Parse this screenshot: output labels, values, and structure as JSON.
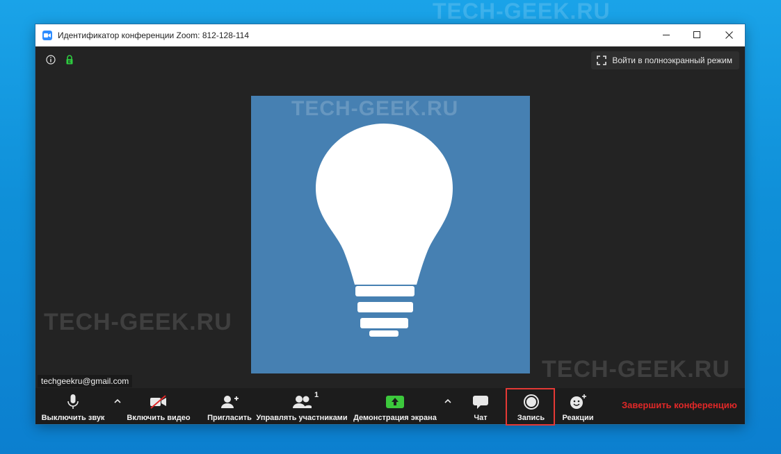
{
  "watermark": "TECH-GEEK.RU",
  "window": {
    "title": "Идентификатор конференции Zoom: 812-128-114",
    "controls": {
      "minimize": "─",
      "maximize": "☐",
      "close": "✕"
    }
  },
  "meeting": {
    "fullscreen_label": "Войти в полноэкранный режим",
    "participant_name": "techgeekru@gmail.com",
    "tile_color": "#4680b2"
  },
  "toolbar": {
    "audio_label": "Выключить звук",
    "video_label": "Включить видео",
    "invite_label": "Пригласить",
    "participants_label": "Управлять участниками",
    "participants_count": "1",
    "share_label": "Демонстрация экрана",
    "chat_label": "Чат",
    "record_label": "Запись",
    "reactions_label": "Реакции",
    "end_label": "Завершить конференцию"
  },
  "colors": {
    "accent_share": "#3cc83c",
    "end_red": "#e02828",
    "highlight_box": "#e53935",
    "secure_green": "#2ecc40"
  }
}
